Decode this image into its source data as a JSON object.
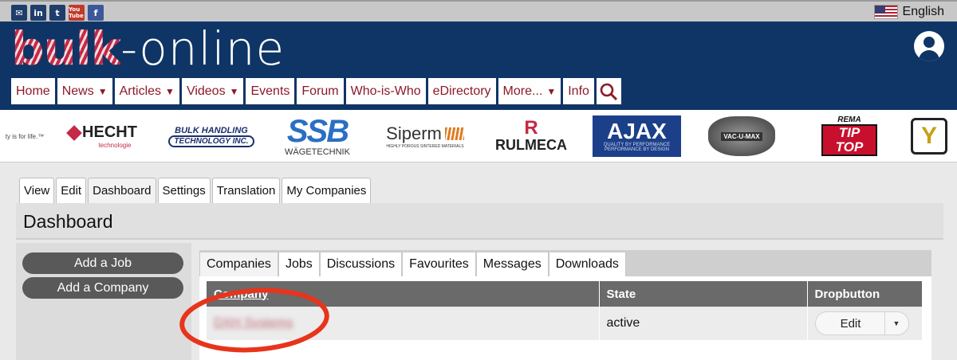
{
  "top_strip": {
    "social": [
      {
        "name": "email",
        "glyph": "✉"
      },
      {
        "name": "linkedin",
        "glyph": "in"
      },
      {
        "name": "twitter",
        "glyph": "t"
      },
      {
        "name": "youtube",
        "glyph": "You Tube"
      },
      {
        "name": "facebook",
        "glyph": "f"
      }
    ],
    "language": "English"
  },
  "header": {
    "logo_bulk": "bulk",
    "logo_dash": "-",
    "logo_online": "online"
  },
  "nav": [
    {
      "label": "Home",
      "dropdown": false
    },
    {
      "label": "News",
      "dropdown": true
    },
    {
      "label": "Articles",
      "dropdown": true
    },
    {
      "label": "Videos",
      "dropdown": true
    },
    {
      "label": "Events",
      "dropdown": false
    },
    {
      "label": "Forum",
      "dropdown": false
    },
    {
      "label": "Who-is-Who",
      "dropdown": false
    },
    {
      "label": "eDirectory",
      "dropdown": false
    },
    {
      "label": "More...",
      "dropdown": true
    },
    {
      "label": "Info",
      "dropdown": false
    }
  ],
  "sponsors": {
    "s1": "ty is for life.™",
    "s2": "HECHT",
    "s2_sub": "technologie",
    "s3a": "BULK HANDLING",
    "s3b": "TECHNOLOGY INC.",
    "s4": "SSB",
    "s4_sub": "WÄGETECHNIK",
    "s5": "Siperm",
    "s5_sub": "HIGHLY POROUS SINTERED MATERIALS",
    "s6": "RULMECA",
    "s7": "AJAX",
    "s7_sub1": "QUALITY BY PERFORMANCE",
    "s7_sub2": "PERFORMANCE BY DESIGN",
    "s8": "VAC-U-MAX",
    "s9a": "REMA",
    "s9b": "TIP TOP"
  },
  "page_tabs": [
    "View",
    "Edit",
    "Dashboard",
    "Settings",
    "Translation",
    "My Companies"
  ],
  "page_title": "Dashboard",
  "sidebar": {
    "add_job": "Add a Job",
    "add_company": "Add a Company"
  },
  "inner_tabs": [
    "Companies",
    "Jobs",
    "Discussions",
    "Favourites",
    "Messages",
    "Downloads"
  ],
  "table": {
    "headers": [
      "Company",
      "State",
      "Dropbutton"
    ],
    "rows": [
      {
        "company": "DXH Systems",
        "state": "active",
        "action": "Edit"
      }
    ]
  },
  "colors": {
    "header_bg": "#0f3566",
    "nav_text": "#8b1a28",
    "annotation": "#e8341c"
  }
}
